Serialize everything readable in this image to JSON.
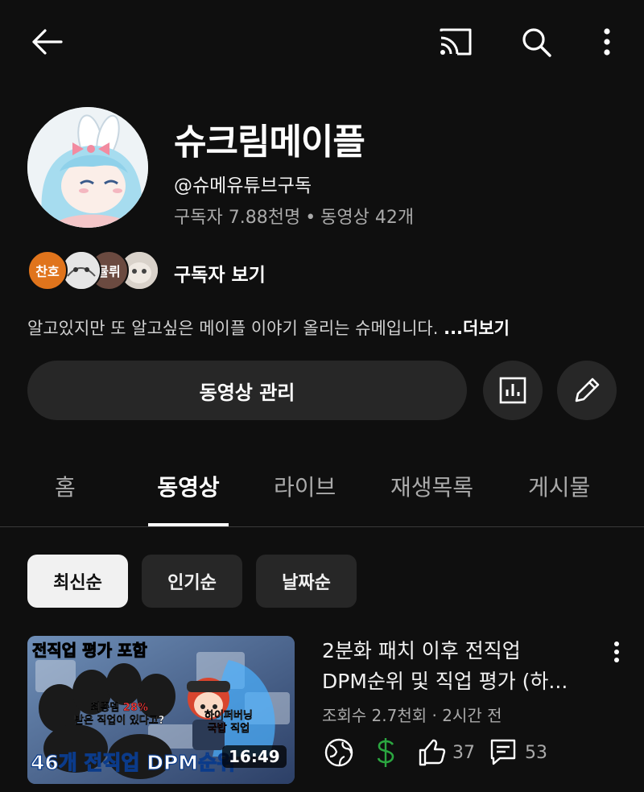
{
  "header": {
    "icons": [
      "back-arrow-icon",
      "cast-icon",
      "search-icon",
      "more-vert-icon"
    ]
  },
  "channel": {
    "name": "슈크림메이플",
    "handle": "@슈메유튜브구독",
    "subscribers": "구독자 7.88천명",
    "separator": "•",
    "video_count": "동영상 42개",
    "subscriber_avatars": [
      {
        "label": "찬호",
        "color": "#e0741c"
      },
      {
        "label": "",
        "color": "#d8d8d8"
      },
      {
        "label": "뮬뤼",
        "color": "#6b4a40"
      },
      {
        "label": "",
        "color": "#cfc8c0"
      }
    ],
    "view_subscribers_label": "구독자 보기",
    "description": "알고있지만 또 알고싶은 메이플 이야기 올리는 슈메입니다. ",
    "description_more": "...더보기"
  },
  "actions": {
    "manage_videos_label": "동영상 관리",
    "analytics_icon": "analytics-icon",
    "edit_icon": "edit-pencil-icon"
  },
  "tabs": [
    {
      "label": "홈",
      "active": false
    },
    {
      "label": "동영상",
      "active": true
    },
    {
      "label": "라이브",
      "active": false
    },
    {
      "label": "재생목록",
      "active": false
    },
    {
      "label": "게시물",
      "active": false
    }
  ],
  "chips": [
    {
      "label": "최신순",
      "selected": true
    },
    {
      "label": "인기순",
      "selected": false
    },
    {
      "label": "날짜순",
      "selected": false
    }
  ],
  "video": {
    "title_line1": "2분화 패치 이후 전직업",
    "title_line2": "DPM순위 및 직업 평가 (하...",
    "views": "조회수 2.7천회",
    "meta_separator": "·",
    "age": "2시간 전",
    "duration": "16:49",
    "likes": "37",
    "comments": "53",
    "thumbnail": {
      "top_text": "전직업 평가 포함",
      "mid_text_a": "최종뎀",
      "mid_pct": "28%",
      "mid_text_b": "받은 직업이 있다고?",
      "right_text_a": "하이퍼버닝",
      "right_text_b": "국밥",
      "right_text_c": "직업",
      "bottom_text": "46개 전직업 DPM순위"
    },
    "accent_green": "#2ba640"
  }
}
